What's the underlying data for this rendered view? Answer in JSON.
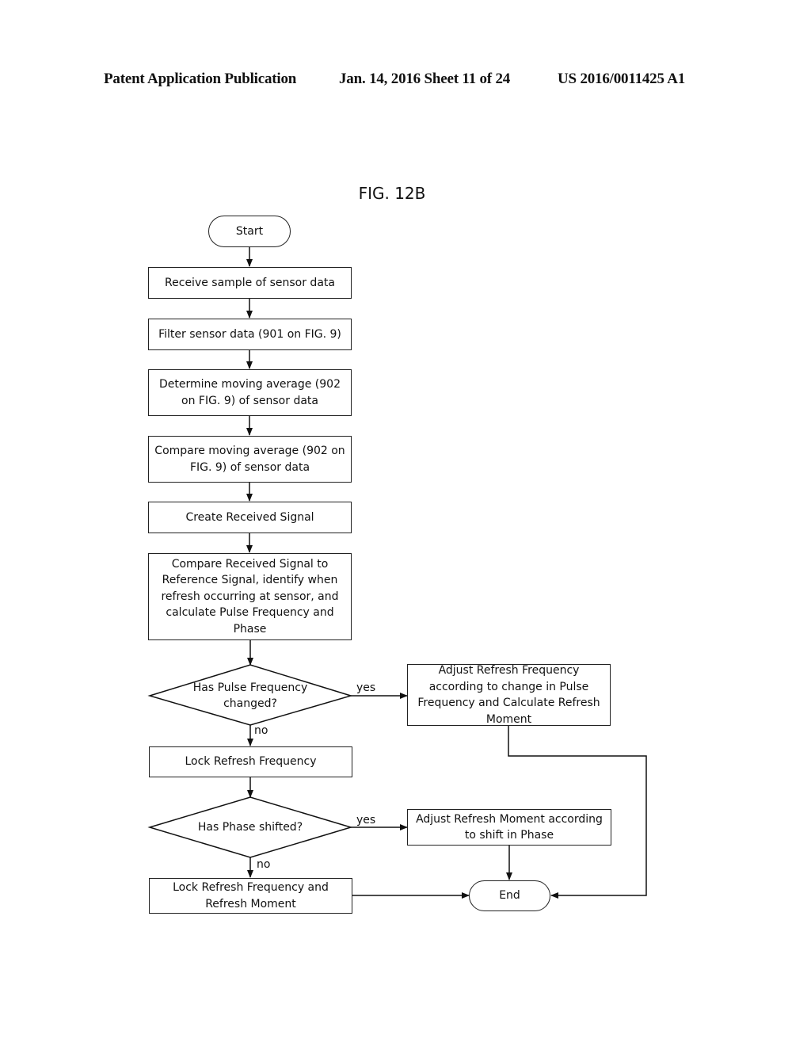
{
  "header": {
    "publication": "Patent Application Publication",
    "date_sheet": "Jan. 14, 2016  Sheet 11 of 24",
    "number": "US 2016/0011425 A1"
  },
  "figure": {
    "title": "FIG. 12B"
  },
  "flowchart": {
    "start": "Start",
    "steps": [
      "Receive sample of sensor data",
      "Filter sensor data (901 on FIG. 9)",
      "Determine moving average (902 on FIG. 9) of sensor data",
      "Compare moving average (902 on FIG. 9) of sensor data",
      "Create Received Signal",
      "Compare Received Signal to Reference Signal, identify when refresh occurring at sensor, and calculate Pulse Frequency and Phase"
    ],
    "decision1": {
      "question": "Has Pulse Frequency changed?",
      "yes_label": "yes",
      "no_label": "no",
      "yes_action": "Adjust Refresh Frequency according to change in Pulse Frequency and Calculate Refresh Moment",
      "no_action": "Lock Refresh Frequency"
    },
    "decision2": {
      "question": "Has Phase shifted?",
      "yes_label": "yes",
      "no_label": "no",
      "yes_action": "Adjust Refresh Moment according to shift in Phase",
      "no_action": "Lock Refresh Frequency and Refresh Moment"
    },
    "end": "End"
  }
}
